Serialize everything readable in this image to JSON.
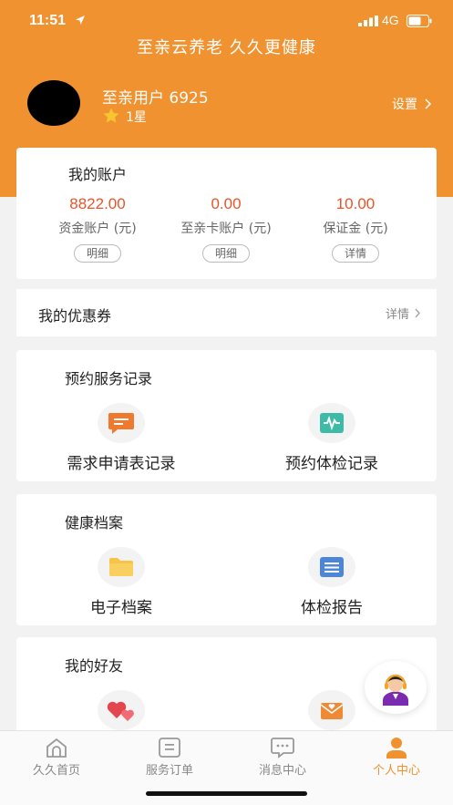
{
  "status_bar": {
    "time": "11:51",
    "network": "4G"
  },
  "header": {
    "title": "至亲云养老 久久更健康",
    "user_name": "至亲用户 6925",
    "level": "1星",
    "settings_label": "设置"
  },
  "account": {
    "title": "我的账户",
    "columns": [
      {
        "value": "8822.00",
        "label": "资金账户 (元)",
        "button": "明细"
      },
      {
        "value": "0.00",
        "label": "至亲卡账户 (元)",
        "button": "明细"
      },
      {
        "value": "10.00",
        "label": "保证金 (元)",
        "button": "详情"
      }
    ]
  },
  "coupon": {
    "title": "我的优惠券",
    "detail": "详情"
  },
  "appointments": {
    "title": "预约服务记录",
    "items": [
      {
        "label": "需求申请表记录",
        "icon": "chat-form-icon"
      },
      {
        "label": "预约体检记录",
        "icon": "health-monitor-icon"
      }
    ]
  },
  "health": {
    "title": "健康档案",
    "items": [
      {
        "label": "电子档案",
        "icon": "folder-icon"
      },
      {
        "label": "体检报告",
        "icon": "report-icon"
      }
    ]
  },
  "friends": {
    "title": "我的好友",
    "items": [
      {
        "icon": "hearts-icon"
      },
      {
        "icon": "mail-heart-icon"
      }
    ]
  },
  "tabs": [
    {
      "label": "久久首页",
      "icon": "home-icon",
      "active": false
    },
    {
      "label": "服务订单",
      "icon": "order-icon",
      "active": false
    },
    {
      "label": "消息中心",
      "icon": "message-icon",
      "active": false
    },
    {
      "label": "个人中心",
      "icon": "person-icon",
      "active": true
    }
  ],
  "colors": {
    "brand": "#f0922f",
    "amount": "#e9542a"
  }
}
